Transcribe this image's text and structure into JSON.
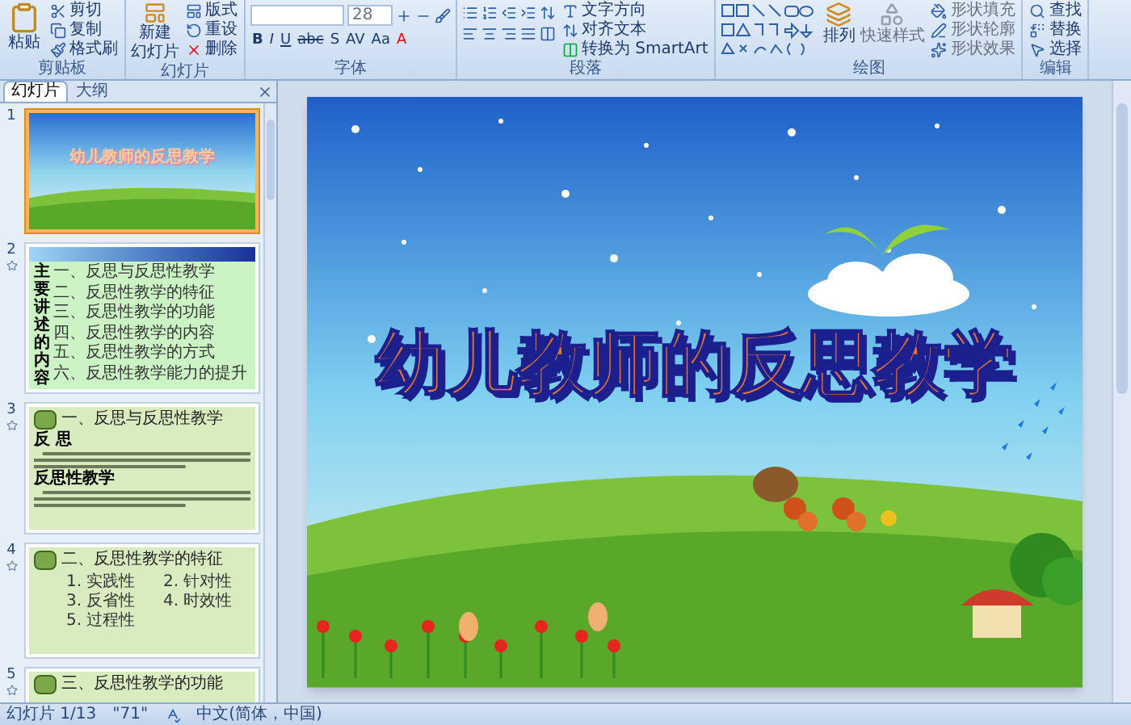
{
  "ribbon": {
    "clipboard": {
      "label": "剪贴板",
      "paste": "粘贴",
      "items": [
        "剪切",
        "复制",
        "格式刷"
      ]
    },
    "slides": {
      "label": "幻灯片",
      "new_slide": [
        "新建",
        "幻灯片"
      ],
      "items": [
        "版式",
        "重设",
        "删除"
      ]
    },
    "font": {
      "label": "字体",
      "size": "28",
      "buttons": [
        "B",
        "I",
        "U",
        "abc",
        "S",
        "AV",
        "Aa",
        "A"
      ]
    },
    "paragraph": {
      "label": "段落",
      "items": [
        "文字方向",
        "对齐文本",
        "转换为 SmartArt"
      ]
    },
    "drawing": {
      "label": "绘图",
      "arrange": "排列",
      "quick_styles": "快速样式",
      "items": [
        "形状填充",
        "形状轮廓",
        "形状效果"
      ]
    },
    "editing": {
      "label": "编辑",
      "items": [
        "查找",
        "替换",
        "选择"
      ]
    }
  },
  "panel": {
    "tabs": [
      {
        "label": "幻灯片",
        "selected": true
      },
      {
        "label": "大纲",
        "selected": false
      }
    ],
    "slides": [
      {
        "number": "1",
        "kind": "title",
        "selected": true,
        "title": "幼儿教师的反思教学"
      },
      {
        "number": "2",
        "kind": "contents",
        "selected": false,
        "title": "主要讲述的内容",
        "items": [
          "一、反思与反思性教学",
          "二、反思性教学的特征",
          "三、反思性教学的功能",
          "四、反思性教学的内容",
          "五、反思性教学的方式",
          "六、反思性教学能力的提升"
        ]
      },
      {
        "number": "3",
        "kind": "sections",
        "selected": false,
        "title": "一、反思与反思性教学",
        "sections": [
          "反 思",
          "反思性教学"
        ]
      },
      {
        "number": "4",
        "kind": "list",
        "selected": false,
        "title": "二、反思性教学的特征",
        "items": [
          "1. 实践性",
          "2. 针对性",
          "3. 反省性",
          "4. 时效性",
          "5. 过程性"
        ]
      },
      {
        "number": "5",
        "kind": "list",
        "selected": false,
        "title": "三、反思性教学的功能"
      }
    ]
  },
  "slide": {
    "title": "幼儿教师的反思教学"
  },
  "status_bar": {
    "slide": "幻灯片 1/13",
    "theme": "\"71\"",
    "language": "中文(简体，中国)"
  }
}
